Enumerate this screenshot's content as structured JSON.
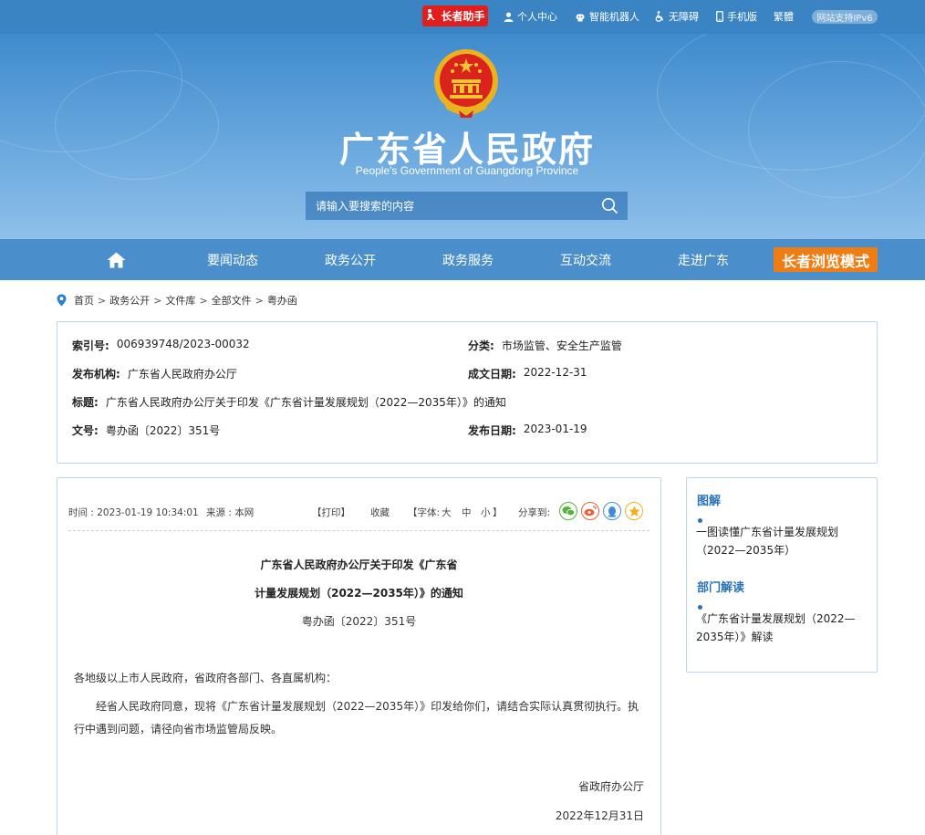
{
  "topbar": {
    "elder_helper": "长者助手",
    "personal_center": "个人中心",
    "robot": "智能机器人",
    "accessibility": "无障碍",
    "mobile": "手机版",
    "traditional": "繁體",
    "ipv6": "网站支持IPv6"
  },
  "banner": {
    "title": "广东省人民政府",
    "subtitle": "People's Government of Guangdong Province",
    "search_placeholder": "请输入要搜索的内容"
  },
  "nav": {
    "items": [
      "要闻动态",
      "政务公开",
      "政务服务",
      "互动交流",
      "走进广东"
    ],
    "elder_mode": "长者浏览模式"
  },
  "breadcrumb": [
    "首页",
    "政务公开",
    "文件库",
    "全部文件",
    "粤办函"
  ],
  "info": {
    "index_no_label": "索引号:",
    "index_no": "006939748/2023-00032",
    "category_label": "分类:",
    "category": "市场监管、安全生产监管",
    "publisher_label": "发布机构:",
    "publisher": "广东省人民政府办公厅",
    "created_label": "成文日期:",
    "created": "2022-12-31",
    "title_label": "标题:",
    "title": "广东省人民政府办公厅关于印发《广东省计量发展规划（2022—2035年）》的通知",
    "doc_no_label": "文号:",
    "doc_no": "粤办函〔2022〕351号",
    "published_label": "发布日期:",
    "published": "2023-01-19"
  },
  "article": {
    "time": "时间 : 2023-01-19 10:34:01",
    "source": "来源 : 本网",
    "print": "【打印】",
    "favorite": "收藏",
    "font_label": "【字体:",
    "font_large": "大",
    "font_medium": "中",
    "font_small": "小",
    "font_close": "】",
    "share_label": "分享到:",
    "title_line1": "广东省人民政府办公厅关于印发《广东省",
    "title_line2": "计量发展规划（2022—2035年）》的通知",
    "doc_no": "粤办函〔2022〕351号",
    "salutation": "各地级以上市人民政府，省政府各部门、各直属机构：",
    "body": "经省人民政府同意，现将《广东省计量发展规划（2022—2035年）》印发给你们，请结合实际认真贯彻执行。执行中遇到问题，请径向省市场监管局反映。",
    "signature": "省政府办公厅",
    "date": "2022年12月31日"
  },
  "sidebar": {
    "section1_title": "图解",
    "section1_link": "一图读懂广东省计量发展规划（2022—2035年）",
    "section2_title": "部门解读",
    "section2_link": "《广东省计量发展规划（2022—2035年）》解读"
  },
  "colors": {
    "topbar": "#3b84c4",
    "nav": "#4a8fcb",
    "elder_red": "#e11d1d",
    "elder_mode_orange": "#f07c14",
    "accent_blue": "#2a73b8"
  }
}
